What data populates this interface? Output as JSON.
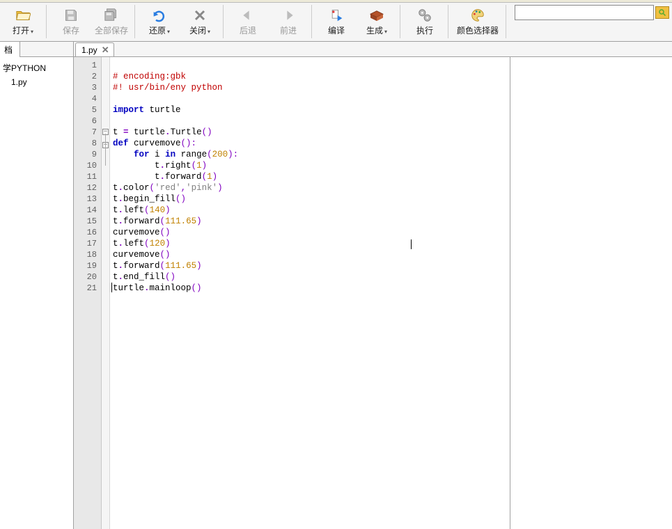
{
  "toolbar": {
    "open": {
      "label": "打开",
      "has_drop": true
    },
    "save": {
      "label": "保存"
    },
    "saveall": {
      "label": "全部保存"
    },
    "revert": {
      "label": "还原",
      "has_drop": true
    },
    "close": {
      "label": "关闭",
      "has_drop": true
    },
    "back": {
      "label": "后退",
      "disabled": true
    },
    "forward": {
      "label": "前进",
      "disabled": true
    },
    "compile": {
      "label": "编译"
    },
    "build": {
      "label": "生成",
      "has_drop": true
    },
    "run": {
      "label": "执行"
    },
    "colorpicker": {
      "label": "颜色选择器"
    }
  },
  "search_placeholder": "",
  "sidebar": {
    "tab_label": "档",
    "items": [
      {
        "label": "学PYTHON"
      },
      {
        "label": "1.py"
      }
    ]
  },
  "file_tab": {
    "label": "1.py",
    "close": "✕"
  },
  "line_count": 21,
  "fold_markers": {
    "line7": "⊟",
    "line8": "⊟",
    "connect_from": 7,
    "connect_to": 10
  },
  "code": {
    "l1": {
      "comment": "# encoding:gbk"
    },
    "l2": {
      "comment": "#! usr/bin/eny python"
    },
    "l3": {
      "blank": ""
    },
    "l4": {
      "kw": "import",
      "mod": " turtle"
    },
    "l5": {
      "blank": ""
    },
    "l6": {
      "pre": "t ",
      "op": "=",
      "post": " turtle",
      "dot": ".",
      "call": "Turtle",
      "p": "()"
    },
    "l7": {
      "kw": "def",
      "sp": " ",
      "name": "curvemove",
      "p": "():"
    },
    "l8": {
      "indent": "    ",
      "kw": "for",
      "sp1": " ",
      "var": "i",
      "sp2": " ",
      "kw2": "in",
      "sp3": " ",
      "fn": "range",
      "po": "(",
      "num": "200",
      "pc": "):"
    },
    "l9": {
      "indent": "        ",
      "obj": "t",
      "dot": ".",
      "fn": "right",
      "po": "(",
      "num": "1",
      "pc": ")"
    },
    "l10": {
      "indent": "        ",
      "obj": "t",
      "dot": ".",
      "fn": "forward",
      "po": "(",
      "num": "1",
      "pc": ")"
    },
    "l11": {
      "obj": "t",
      "dot": ".",
      "fn": "color",
      "po": "(",
      "s1": "'red'",
      "comma": ",",
      "s2": "'pink'",
      "pc": ")"
    },
    "l12": {
      "obj": "t",
      "dot": ".",
      "fn": "begin_fill",
      "p": "()"
    },
    "l13": {
      "obj": "t",
      "dot": ".",
      "fn": "left",
      "po": "(",
      "num": "140",
      "pc": ")"
    },
    "l14": {
      "obj": "t",
      "dot": ".",
      "fn": "forward",
      "po": "(",
      "num": "111.65",
      "pc": ")"
    },
    "l15": {
      "fn": "curvemove",
      "p": "()"
    },
    "l16": {
      "obj": "t",
      "dot": ".",
      "fn": "left",
      "po": "(",
      "num": "120",
      "pc": ")"
    },
    "l17": {
      "fn": "curvemove",
      "p": "()"
    },
    "l18": {
      "obj": "t",
      "dot": ".",
      "fn": "forward",
      "po": "(",
      "num": "111.65",
      "pc": ")"
    },
    "l19": {
      "obj": "t",
      "dot": ".",
      "fn": "end_fill",
      "p": "()"
    },
    "l20": {
      "obj": "turtle",
      "dot": ".",
      "fn": "mainloop",
      "p": "()"
    },
    "l21": {
      "blank": ""
    }
  }
}
